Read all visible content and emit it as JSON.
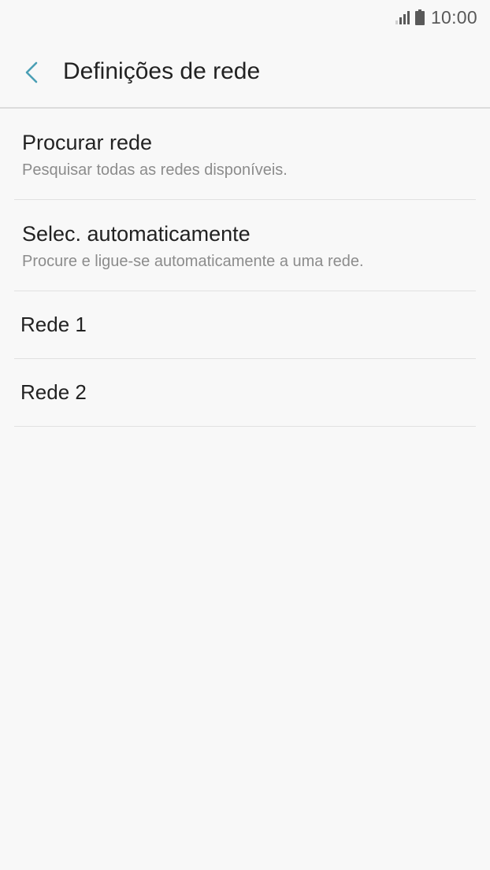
{
  "status_bar": {
    "time": "10:00",
    "signal_icon": "signal-icon",
    "battery_icon": "battery-icon"
  },
  "header": {
    "back_icon": "chevron-left-icon",
    "title": "Definições de rede",
    "accent_color": "#4a9fb5"
  },
  "settings": {
    "items": [
      {
        "title": "Procurar rede",
        "subtitle": "Pesquisar todas as redes disponíveis."
      },
      {
        "title": "Selec. automaticamente",
        "subtitle": "Procure e ligue-se automaticamente a uma rede."
      },
      {
        "title": "Rede 1"
      },
      {
        "title": "Rede 2"
      }
    ]
  }
}
